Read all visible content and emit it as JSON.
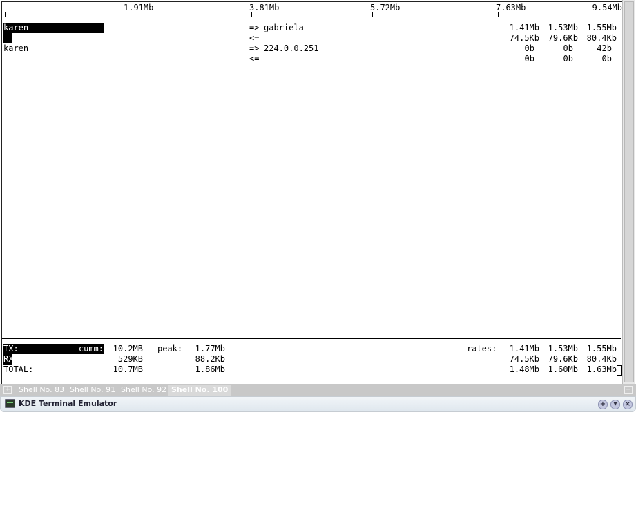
{
  "scale": {
    "ticks": [
      "1.91Mb",
      "3.81Mb",
      "5.72Mb",
      "7.63Mb",
      "9.54Mb"
    ]
  },
  "flows": [
    {
      "host": "karen",
      "dir_out": "=>",
      "dir_in": "<=",
      "peer": "gabriela",
      "out": [
        "1.41Mb",
        "1.53Mb",
        "1.55Mb"
      ],
      "in": [
        "74.5Kb",
        "79.6Kb",
        "80.4Kb"
      ]
    },
    {
      "host": "karen",
      "dir_out": "=>",
      "dir_in": "<=",
      "peer": "224.0.0.251",
      "out": [
        "0b",
        "0b",
        "42b"
      ],
      "in": [
        "0b",
        "0b",
        "0b"
      ]
    }
  ],
  "totals": {
    "tx_label": "TX:",
    "rx_label": "RX:",
    "total_label": "TOTAL:",
    "cumm_label": "cumm:",
    "peak_label": "peak:",
    "rates_label": "rates:",
    "tx": {
      "cumm": "10.2MB",
      "peak": "1.77Mb",
      "rates": [
        "1.41Mb",
        "1.53Mb",
        "1.55Mb"
      ]
    },
    "rx": {
      "cumm": "529KB",
      "peak": "88.2Kb",
      "rates": [
        "74.5Kb",
        "79.6Kb",
        "80.4Kb"
      ]
    },
    "total": {
      "cumm": "10.7MB",
      "peak": "1.86Mb",
      "rates": [
        "1.48Mb",
        "1.60Mb",
        "1.63Mb"
      ]
    }
  },
  "tabs": [
    "Shell No. 83",
    "Shell No. 91",
    "Shell No. 92",
    "Shell No. 100"
  ],
  "active_tab": "Shell No. 100",
  "window": {
    "title": "KDE Terminal Emulator"
  }
}
